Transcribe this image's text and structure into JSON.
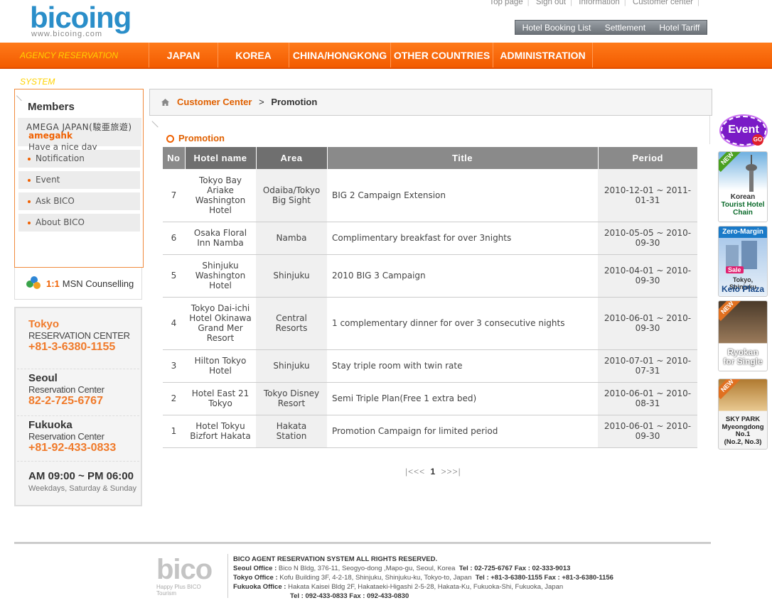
{
  "logo": {
    "name": "bicoing",
    "url": "www.bicoing.com"
  },
  "top_links": [
    "Top page",
    "Sign out",
    "Information",
    "Customer center"
  ],
  "sub_buttons": [
    "Hotel Booking List",
    "Settlement",
    "Hotel Tariff"
  ],
  "nav": {
    "agency": "AGENCY RESERVATION SYSTEM",
    "items": [
      "JAPAN",
      "KOREA",
      "CHINA/HONGKONG",
      "OTHER COUNTRIES",
      "ADMINISTRATION"
    ]
  },
  "members": {
    "title": "Members",
    "company": "AMEGA JAPAN(駿亜旅遊)",
    "user_id": "amegahk",
    "greeting": "Have a nice day",
    "menu": [
      "Notification",
      "Event",
      "Ask BICO",
      "About BICO"
    ]
  },
  "msn": {
    "prefix": "1:1",
    "label": "MSN Counselling"
  },
  "contact": {
    "tokyo": {
      "city": "Tokyo",
      "center": "RESERVATION CENTER",
      "tel": "+81-3-6380-1155"
    },
    "seoul": {
      "city": "Seoul",
      "center": "Reservation Center",
      "tel": "82-2-725-6767"
    },
    "fukuoka": {
      "city": "Fukuoka",
      "center": "Reservation Center",
      "tel": "+81-92-433-0833"
    },
    "hours": "AM 09:00 ~ PM 06:00",
    "days": "Weekdays, Saturday & Sunday"
  },
  "breadcrumb": {
    "parent": "Customer Center",
    "separator": ">",
    "current": "Promotion"
  },
  "page_title": "Promotion",
  "table": {
    "headers": [
      "No",
      "Hotel name",
      "Area",
      "Title",
      "Period"
    ],
    "rows": [
      {
        "no": "7",
        "hotel": "Tokyo Bay Ariake Washington Hotel",
        "area": "Odaiba/Tokyo Big Sight",
        "title": "BIG 2 Campaign Extension",
        "period": "2010-12-01 ~ 2011-01-31"
      },
      {
        "no": "6",
        "hotel": "Osaka Floral Inn Namba",
        "area": "Namba",
        "title": "Complimentary breakfast for over 3nights",
        "period": "2010-05-05 ~ 2010-09-30"
      },
      {
        "no": "5",
        "hotel": "Shinjuku Washington Hotel",
        "area": "Shinjuku",
        "title": "2010 BIG 3 Campaign",
        "period": "2010-04-01 ~ 2010-09-30"
      },
      {
        "no": "4",
        "hotel": "Tokyo Dai-ichi Hotel Okinawa Grand Mer Resort",
        "area": "Central Resorts",
        "title": "1 complementary dinner for over 3 consecutive nights",
        "period": "2010-06-01 ~ 2010-09-30"
      },
      {
        "no": "3",
        "hotel": "Hilton Tokyo Hotel",
        "area": "Shinjuku",
        "title": "Stay triple room with twin rate",
        "period": "2010-07-01 ~ 2010-07-31"
      },
      {
        "no": "2",
        "hotel": "Hotel East 21 Tokyo",
        "area": "Tokyo Disney Resort",
        "title": "Semi Triple Plan(Free 1 extra bed)",
        "period": "2010-06-01 ~ 2010-08-31"
      },
      {
        "no": "1",
        "hotel": "Hotel Tokyu Bizfort Hakata",
        "area": "Hakata Station",
        "title": "Promotion Campaign for limited period",
        "period": "2010-06-01 ~ 2010-09-30"
      }
    ]
  },
  "pager": {
    "first": "|<<",
    "prev": "<",
    "current": "1",
    "next": ">",
    "last": ">>|"
  },
  "side_banners": {
    "event": {
      "label": "Event",
      "go": "GO"
    },
    "korean": {
      "tag": "NEW",
      "line1": "Korean",
      "line2": "Tourist Hotel",
      "line3": "Chain"
    },
    "keio": {
      "tag": "Zero-Margin",
      "sale": "Sale",
      "line1": "Tokyo, Shinjuku",
      "line2": "Keio Plaza"
    },
    "ryokan": {
      "tag": "NEW",
      "line1": "Ryokan",
      "line2": "for Single"
    },
    "skypark": {
      "tag": "NEW",
      "line1": "SKY PARK",
      "line2": "Myeongdong",
      "line3": "No.1",
      "line4": "(No.2, No.3)"
    }
  },
  "footer": {
    "logo": "bico",
    "tagline": "Happy Plus BICO Tourism",
    "rights": "BICO AGENT RESERVATION SYSTEM ALL RIGHTS RESERVED.",
    "seoul_label": "Seoul Office :",
    "seoul": "Bico N Bldg, 376-11, Seogyo-dong ,Mapo-gu, Seoul, Korea",
    "seoul_tel": "Tel : 02-725-6767   Fax : 02-333-9013",
    "tokyo_label": "Tokyo Office :",
    "tokyo": "Kofu Building 3F,  4-2-18, Shinjuku, Shinjuku-ku, Tokyo-to, Japan",
    "tokyo_tel": "Tel : +81-3-6380-1155   Fax : +81-3-6380-1156",
    "fukuoka_label": "Fukuoka Office :",
    "fukuoka": "Hakata Kaisei Bldg 2F, Hakataeki-Higashi 2-5-28, Hakata-Ku, Fukuoka-Shi, Fukuoka, Japan",
    "fukuoka_tel": "Tel : 092-433-0833   Fax : 092-433-0830"
  },
  "colors": {
    "orange": "#f25b00",
    "accent_text": "#e06000",
    "header_gray": "#8a8a8a"
  }
}
